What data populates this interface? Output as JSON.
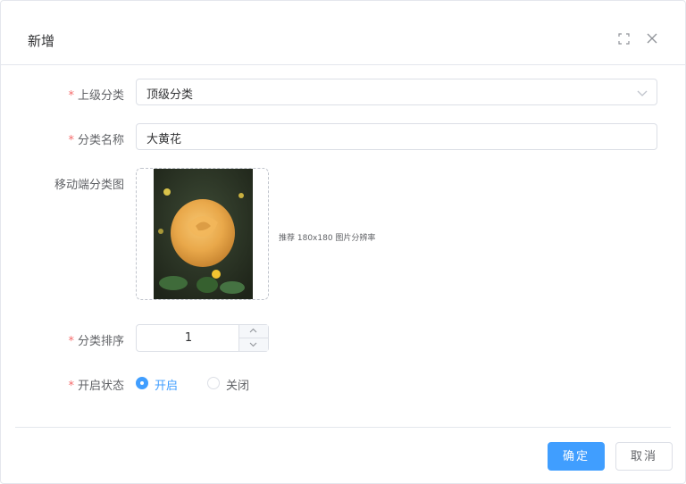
{
  "dialog": {
    "title": "新增",
    "fullscreen_icon": "fullscreen-icon",
    "close_icon": "close-icon"
  },
  "form": {
    "parent_category": {
      "label": "上级分类",
      "required": true,
      "value": "顶级分类"
    },
    "category_name": {
      "label": "分类名称",
      "required": true,
      "value": "大黄花"
    },
    "mobile_image": {
      "label": "移动端分类图",
      "hint": "推荐 180x180 图片分辨率"
    },
    "sort_order": {
      "label": "分类排序",
      "required": true,
      "value": "1"
    },
    "status": {
      "label": "开启状态",
      "required": true,
      "options": [
        {
          "label": "开启",
          "selected": true
        },
        {
          "label": "关闭",
          "selected": false
        }
      ]
    }
  },
  "footer": {
    "confirm_label": "确定",
    "cancel_label": "取消"
  },
  "colors": {
    "primary": "#409eff",
    "required_star": "#f56c6c"
  }
}
